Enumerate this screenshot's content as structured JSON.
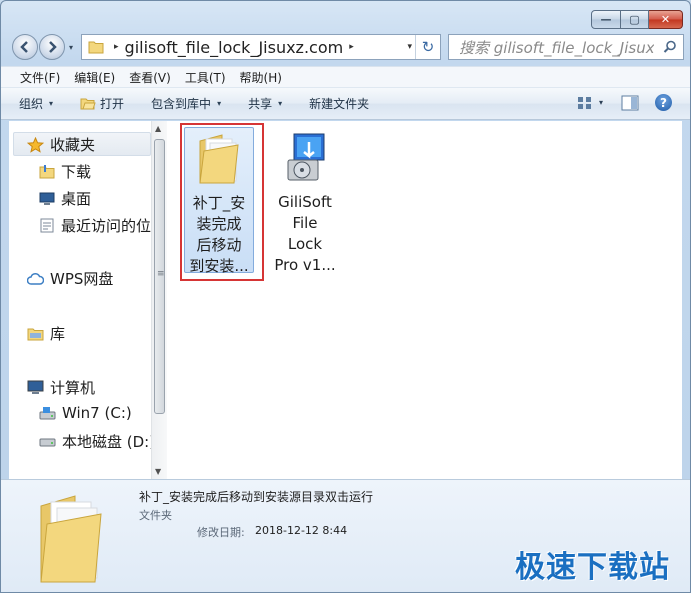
{
  "window": {
    "caption_buttons": {
      "minimize": "—",
      "maximize": "▢",
      "close": "✕"
    }
  },
  "address_bar": {
    "path": "gilisoft_file_lock_Jisuxz.com",
    "separator": "▸",
    "dropdown": "▾",
    "refresh": "↻"
  },
  "search": {
    "placeholder": "搜索 gilisoft_file_lock_Jisuxz..."
  },
  "menu": {
    "items": [
      "文件(F)",
      "编辑(E)",
      "查看(V)",
      "工具(T)",
      "帮助(H)"
    ]
  },
  "toolbar": {
    "organize": "组织",
    "open": "打开",
    "include_library": "包含到库中",
    "share": "共享",
    "new_folder": "新建文件夹",
    "arrow": "▾",
    "help": "?"
  },
  "nav_pane": {
    "favorites": "收藏夹",
    "downloads": "下载",
    "desktop": "桌面",
    "recent": "最近访问的位置",
    "wps": "WPS网盘",
    "libraries": "库",
    "computer": "计算机",
    "drive_c": "Win7 (C:)",
    "drive_d": "本地磁盘 (D:)"
  },
  "files": [
    {
      "lines": [
        "补丁_安",
        "装完成",
        "后移动",
        "到安装..."
      ]
    },
    {
      "lines": [
        "GiliSoft",
        "File",
        "Lock",
        "Pro v1..."
      ]
    }
  ],
  "details": {
    "name": "补丁_安装完成后移动到安装源目录双击运行",
    "type": "文件夹",
    "modified_label": "修改日期:",
    "modified_value": "2018-12-12 8:44"
  },
  "watermark": "极速下载站",
  "colors": {
    "accent": "#1a6fc1",
    "selection_border": "#d63535",
    "folder_yellow": "#f3d77e"
  }
}
